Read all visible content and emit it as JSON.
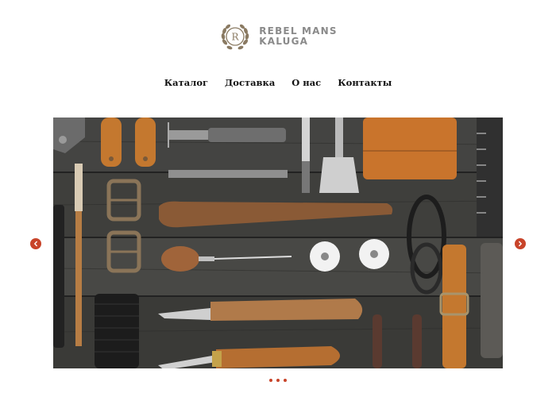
{
  "logo": {
    "monogram": "R",
    "line1": "REBEL MANS",
    "line2": "KALUGA"
  },
  "nav": {
    "items": [
      "Каталог",
      "Доставка",
      "О нас",
      "Контакты"
    ]
  },
  "slider": {
    "image_alt": "Leather craft tools on a dark wooden table",
    "slide_count": 3,
    "active_slide": 1
  },
  "colors": {
    "accent": "#c8442a",
    "logo": "#8a7a62",
    "text": "#111111"
  }
}
